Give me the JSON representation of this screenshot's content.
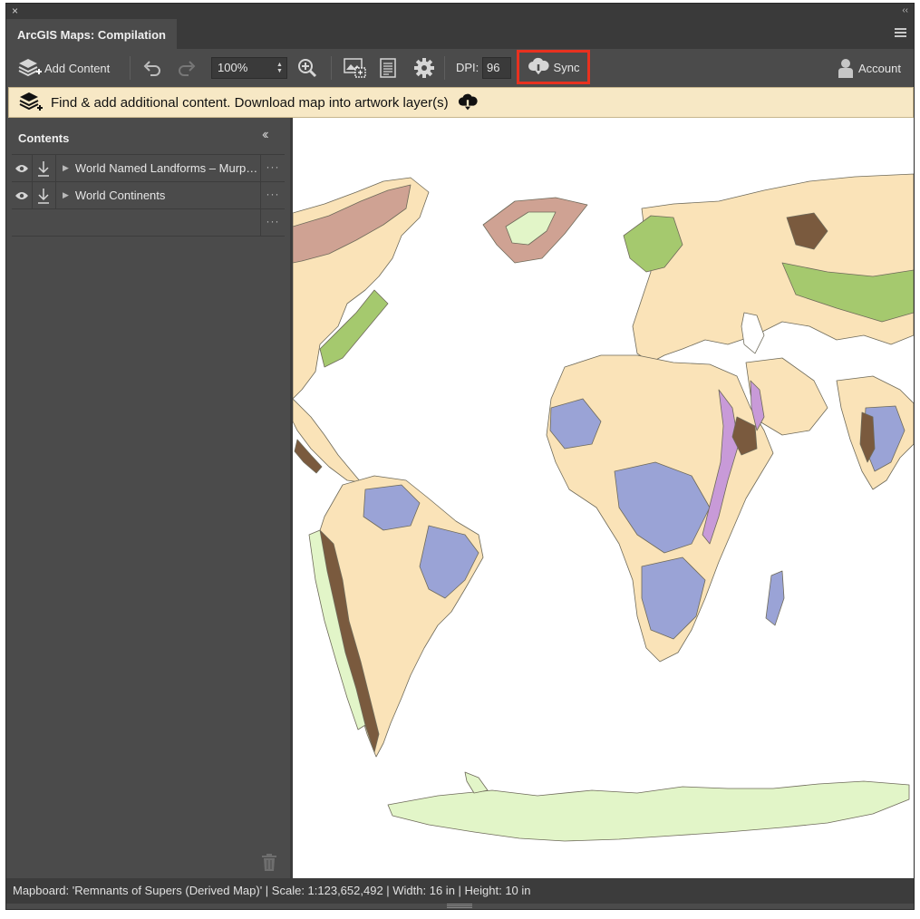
{
  "window": {
    "close_symbol": "×",
    "collapse_symbol": "‹‹"
  },
  "tab": {
    "title": "ArcGIS Maps: Compilation"
  },
  "toolbar": {
    "add_content_label": "Add Content",
    "zoom_value": "100%",
    "dpi_label": "DPI:",
    "dpi_value": "96",
    "sync_label": "Sync",
    "account_label": "Account",
    "icons": [
      "add-content-icon",
      "undo-icon",
      "redo-icon",
      "zoom-in-icon",
      "extent-icon",
      "document-icon",
      "gear-icon",
      "cloud-download-icon",
      "user-icon"
    ]
  },
  "banner": {
    "text": "Find & add additional content. Download map into artwork layer(s)"
  },
  "sidebar": {
    "title": "Contents",
    "layers": [
      {
        "label": "World Named Landforms – Murphy Landforms"
      },
      {
        "label": "World Continents"
      }
    ],
    "more_symbol": "···"
  },
  "map": {
    "colors": {
      "plain": "#fae3b8",
      "plateau": "#9aa3d6",
      "hill": "#a5c96e",
      "mountain_high": "#7a5a3e",
      "mountain_mid": "#cfa293",
      "ice": "#e2f5c8",
      "rift": "#c89ad8",
      "water": "#ffffff",
      "outline": "#6e6a5a"
    }
  },
  "status": {
    "text": "Mapboard: 'Remnants of Supers (Derived Map)' | Scale: 1:123,652,492  | Width: 16 in | Height: 10 in"
  }
}
